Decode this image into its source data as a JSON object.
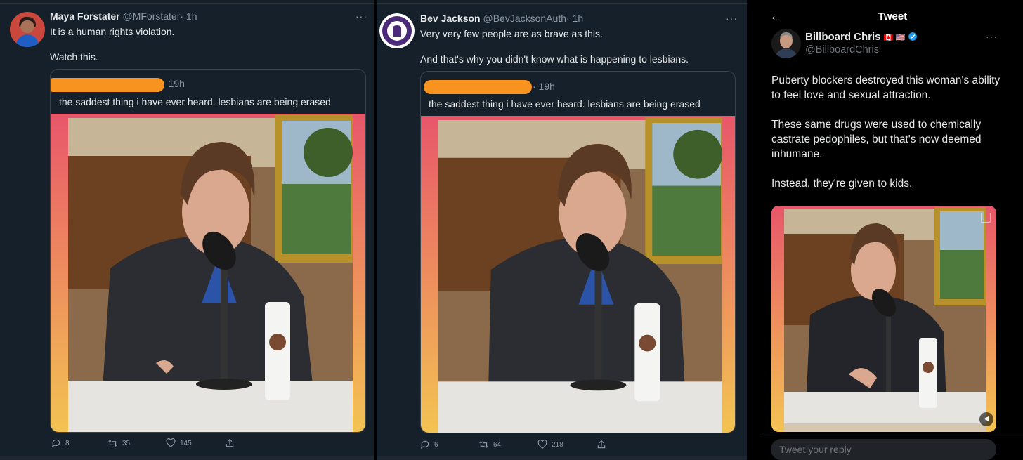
{
  "tweet1": {
    "name": "Maya Forstater",
    "handle": "@MForstater",
    "time": "· 1h",
    "more": "···",
    "text": "It is a human rights violation.\n\nWatch this.",
    "quote_time": "· 19h",
    "quote_text": "the saddest thing i have ever heard. lesbians are being erased",
    "replies": "8",
    "retweets": "35",
    "likes": "145"
  },
  "tweet2": {
    "name": "Bev Jackson",
    "handle": "@BevJacksonAuth",
    "time": "· 1h",
    "more": "···",
    "text": "Very very few people are as brave as this.\n\nAnd that's why you didn't know what is happening to lesbians.",
    "quote_time": "· 19h",
    "quote_text": "the saddest thing i have ever heard. lesbians are being erased",
    "replies": "6",
    "retweets": "64",
    "likes": "218"
  },
  "tweet3": {
    "page_title": "Tweet",
    "name": "Billboard Chris",
    "flags": "🇨🇦 🇺🇸",
    "handle": "@BillboardChris",
    "more": "···",
    "text": "Puberty blockers destroyed this woman's ability to feel love and sexual attraction.\n\nThese same drugs were used to chemically castrate pedophiles, but that's now deemed inhumane.\n\nInstead, they're given to kids.",
    "reply_placeholder": "Tweet your reply"
  },
  "colors": {
    "background": "#15202b",
    "accent": "#1d9bf0",
    "redaction": "#f7931e",
    "video_gradient_top": "#e8566a",
    "video_gradient_bottom": "#f3c452"
  }
}
